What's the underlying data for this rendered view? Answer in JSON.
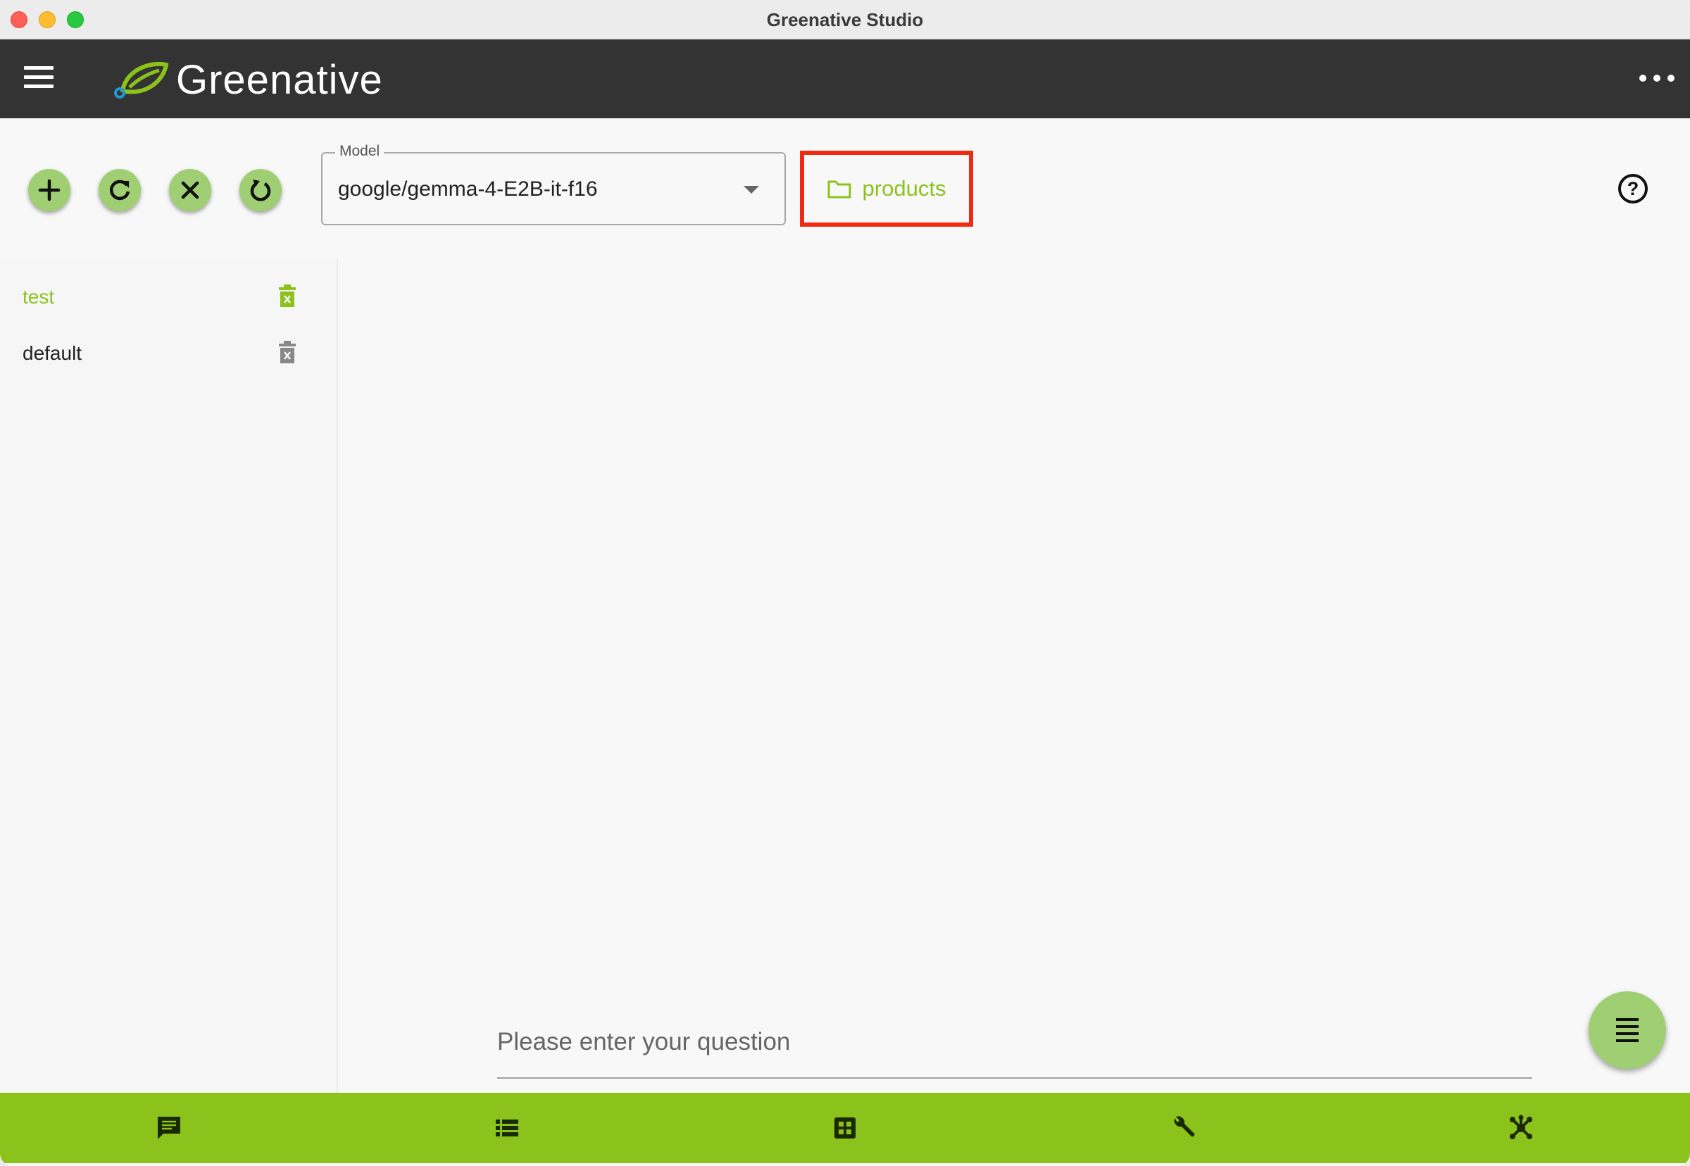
{
  "window": {
    "title": "Greenative Studio"
  },
  "appbar": {
    "brand": "Greenative",
    "menu_icon": "hamburger-icon",
    "more_icon": "more-horiz-icon"
  },
  "toolbar": {
    "buttons": [
      {
        "name": "add-button",
        "icon": "plus-icon"
      },
      {
        "name": "refresh-button",
        "icon": "refresh-icon"
      },
      {
        "name": "clear-button",
        "icon": "close-icon"
      },
      {
        "name": "reset-button",
        "icon": "restart-icon"
      }
    ],
    "model": {
      "label": "Model",
      "value": "google/gemma-4-E2B-it-f16"
    },
    "folder": {
      "label": "products",
      "icon": "folder-icon"
    },
    "help_icon": "help-circle-icon",
    "help_glyph": "?"
  },
  "sidebar": {
    "conversations": [
      {
        "label": "test",
        "active": true
      },
      {
        "label": "default",
        "active": false
      }
    ]
  },
  "chat": {
    "placeholder": "Please enter your question"
  },
  "bottom_nav": [
    "chat-icon",
    "list-icon",
    "grid-icon",
    "wrench-icon",
    "network-icon"
  ],
  "colors": {
    "accent": "#8bc21b",
    "fab": "#9fcf72",
    "appbar": "#333333",
    "highlight": "#f02a12"
  }
}
